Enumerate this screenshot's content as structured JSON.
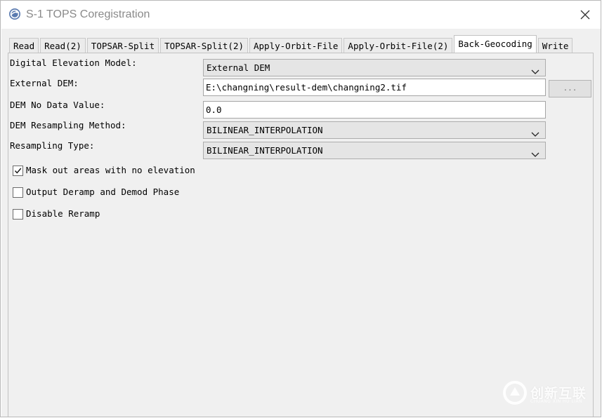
{
  "window": {
    "title": "S-1 TOPS Coregistration"
  },
  "tabs": [
    {
      "label": "Read",
      "active": false
    },
    {
      "label": "Read(2)",
      "active": false
    },
    {
      "label": "TOPSAR-Split",
      "active": false
    },
    {
      "label": "TOPSAR-Split(2)",
      "active": false
    },
    {
      "label": "Apply-Orbit-File",
      "active": false
    },
    {
      "label": "Apply-Orbit-File(2)",
      "active": false
    },
    {
      "label": "Back-Geocoding",
      "active": true
    },
    {
      "label": "Write",
      "active": false
    }
  ],
  "form": {
    "dem": {
      "label": "Digital Elevation Model:",
      "value": "External DEM"
    },
    "external_dem": {
      "label": "External DEM:",
      "value": "E:\\changning\\result-dem\\changning2.tif",
      "browse_label": "..."
    },
    "no_data": {
      "label": "DEM No Data Value:",
      "value": "0.0"
    },
    "dem_resampling": {
      "label": "DEM Resampling Method:",
      "value": "BILINEAR_INTERPOLATION"
    },
    "resampling_type": {
      "label": "Resampling Type:",
      "value": "BILINEAR_INTERPOLATION"
    }
  },
  "checkboxes": [
    {
      "label": "Mask out areas with no elevation",
      "checked": true
    },
    {
      "label": "Output Deramp and Demod Phase",
      "checked": false
    },
    {
      "label": "Disable Reramp",
      "checked": false
    }
  ],
  "watermark": {
    "text": "创新互联",
    "sub": "CHUANG XIN HU LIAN"
  },
  "colors": {
    "background": "#f0f0f0",
    "title_text": "#8a8a8a",
    "icon_blue": "#4a6fa5"
  }
}
